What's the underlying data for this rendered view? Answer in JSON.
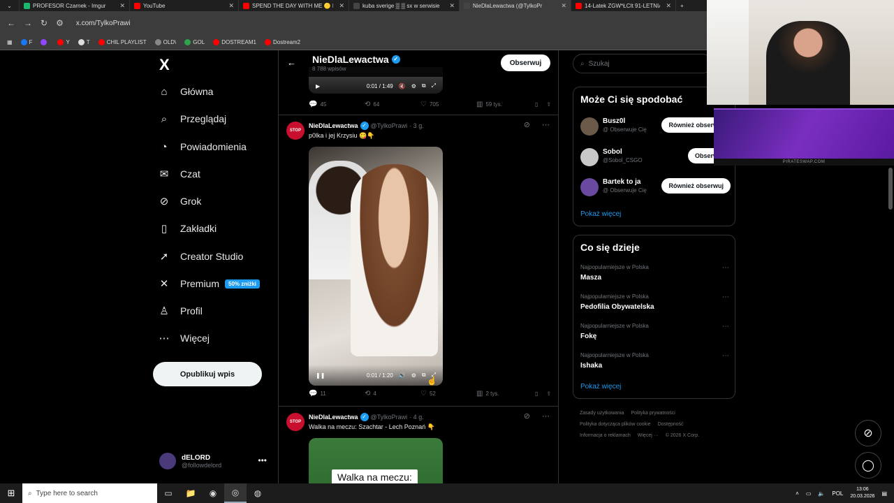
{
  "browser": {
    "tabs": [
      {
        "title": "PROFESOR Czarnek - Imgur",
        "color": "#1bb76e"
      },
      {
        "title": "YouTube",
        "color": "#ff0000"
      },
      {
        "title": "SPEND THE DAY WITH ME 🟡 D",
        "color": "#ff0000"
      },
      {
        "title": "kuba sverige ▒ ▒ sx w serwisie",
        "color": "#444444"
      },
      {
        "title": "NieDlaLewactwa (@TylkoPr",
        "color": "#444444",
        "active": true
      },
      {
        "title": "14-Latek ZGW*ŁCIt 91-LETNIĄ",
        "color": "#ff0000"
      }
    ],
    "url": "x.com/TylkoPrawi",
    "bookmarks": [
      {
        "label": "F",
        "color": "#1877f2"
      },
      {
        "label": "",
        "color": "#9146ff"
      },
      {
        "label": "Y",
        "color": "#ff0000"
      },
      {
        "label": "T",
        "color": "#dddddd"
      },
      {
        "label": "CHIL PLAYLIST",
        "color": "#ff0000"
      },
      {
        "label": "OLD\\",
        "color": "#888888"
      },
      {
        "label": "GOL",
        "color": "#2ea44f"
      },
      {
        "label": "DOSTREAM1",
        "color": "#ff0000"
      },
      {
        "label": "Dostream2",
        "color": "#ff0000"
      }
    ]
  },
  "nav": {
    "logo": "X",
    "items": [
      {
        "label": "Główna",
        "icon": "home-icon"
      },
      {
        "label": "Przeglądaj",
        "icon": "search-icon"
      },
      {
        "label": "Powiadomienia",
        "icon": "bell-icon"
      },
      {
        "label": "Czat",
        "icon": "mail-icon"
      },
      {
        "label": "Grok",
        "icon": "grok-icon"
      },
      {
        "label": "Zakładki",
        "icon": "bookmark-icon"
      },
      {
        "label": "Creator Studio",
        "icon": "rocket-icon"
      },
      {
        "label": "Premium",
        "icon": "x-icon",
        "badge": "50% zniżki"
      },
      {
        "label": "Profil",
        "icon": "person-icon"
      },
      {
        "label": "Więcej",
        "icon": "more-icon"
      }
    ],
    "post_button": "Opublikuj wpis",
    "user": {
      "name": "dELORD",
      "handle": "@followdelord"
    }
  },
  "profile": {
    "name": "NieDlaLewactwa",
    "count": "8 788 wpisów",
    "follow_label": "Obserwuj"
  },
  "top_video": {
    "time": "0:01 / 1:49"
  },
  "top_actions": {
    "replies": "45",
    "reposts": "64",
    "likes": "705",
    "views": "59 tys."
  },
  "tweets": [
    {
      "name": "NieDlaLewactwa",
      "handle": "@TylkoPrawi",
      "age": "· 3 g.",
      "text": "p0lka i jej Krzysiu 😋👇",
      "video_time": "0:01 / 1:20",
      "replies": "11",
      "reposts": "4",
      "likes": "52",
      "views": "2 tys."
    },
    {
      "name": "NieDlaLewactwa",
      "handle": "@TylkoPrawi",
      "age": "· 4 g.",
      "text": "Walka na meczu: Szachtar - Lech Poznań 👇",
      "overlay": "Walka na meczu:"
    }
  ],
  "right": {
    "search_placeholder": "Szukaj",
    "suggest_title": "Może Ci się spodobać",
    "suggestions": [
      {
        "name": "Busz0l",
        "handle": "@",
        "sub": "Obserwuje Cię",
        "button": "Również obserwuj",
        "color": "#6b5a4a"
      },
      {
        "name": "Sobol",
        "handle": "@Sobol_CSGO",
        "sub": "",
        "button": "Obserwuj",
        "color": "#c8c8c8"
      },
      {
        "name": "Bartek to ja",
        "handle": "@",
        "sub": "Obserwuje Cię",
        "button": "Również obserwuj",
        "color": "#6a4aa0"
      }
    ],
    "more_label": "Pokaż więcej",
    "trends_title": "Co się dzieje",
    "trends": [
      {
        "category": "Najpopularniejsze w Polska",
        "name": "Masza"
      },
      {
        "category": "Najpopularniejsze w Polska",
        "name": "Pedofilia Obywatelska"
      },
      {
        "category": "Najpopularniejsze w Polska",
        "name": "Fokę"
      },
      {
        "category": "Najpopularniejsze w Polska",
        "name": "Ishaka"
      }
    ],
    "trends_more": "Pokaż więcej",
    "footer": [
      "Zasady użytkowania",
      "Polityka prywatności",
      "Polityka dotycząca plików cookie",
      "Dostępność",
      "Informacja o reklamach",
      "Więcej ···",
      "© 2026 X Corp."
    ]
  },
  "overlay": {
    "promo_label": "PIRATESWAP.COM"
  },
  "taskbar": {
    "search_placeholder": "Type here to search",
    "lang": "POL",
    "time": "13:06",
    "date": "20.03.2026"
  }
}
